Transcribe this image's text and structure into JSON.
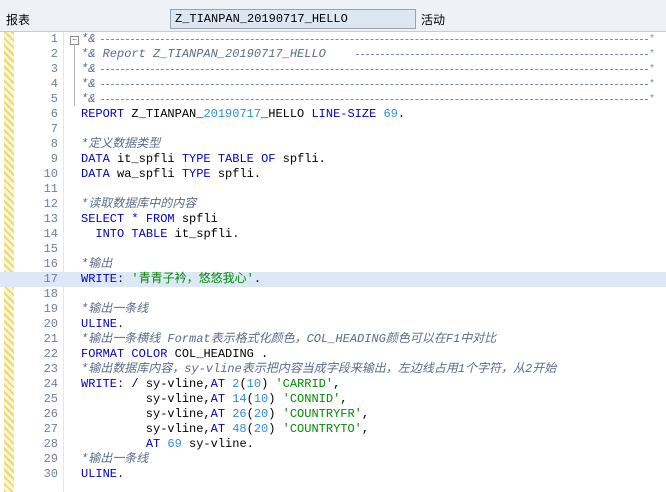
{
  "header": {
    "label": "报表",
    "program_name": "Z_TIANPAN_20190717_HELLO",
    "status": "活动"
  },
  "editor": {
    "highlighted_line": 17,
    "lines": [
      {
        "num": "1",
        "text": "*&"
      },
      {
        "num": "2",
        "text": "*& Report Z_TIANPAN_20190717_HELLO"
      },
      {
        "num": "3",
        "text": "*&"
      },
      {
        "num": "4",
        "text": "*&"
      },
      {
        "num": "5",
        "text": "*&"
      },
      {
        "num": "6",
        "text": "REPORT Z_TIANPAN_20190717_HELLO LINE-SIZE 69."
      },
      {
        "num": "7",
        "text": ""
      },
      {
        "num": "8",
        "text": "*定义数据类型"
      },
      {
        "num": "9",
        "text": "DATA it_spfli TYPE TABLE OF spfli."
      },
      {
        "num": "10",
        "text": "DATA wa_spfli TYPE spfli."
      },
      {
        "num": "11",
        "text": ""
      },
      {
        "num": "12",
        "text": "*读取数据库中的内容"
      },
      {
        "num": "13",
        "text": "SELECT * FROM spfli"
      },
      {
        "num": "14",
        "text": "  INTO TABLE it_spfli."
      },
      {
        "num": "15",
        "text": ""
      },
      {
        "num": "16",
        "text": "*输出"
      },
      {
        "num": "17",
        "text": "WRITE: '青青子衿，悠悠我心'."
      },
      {
        "num": "18",
        "text": ""
      },
      {
        "num": "19",
        "text": "*输出一条线"
      },
      {
        "num": "20",
        "text": "ULINE."
      },
      {
        "num": "21",
        "text": "*输出一条横线 Format表示格式化颜色，COL_HEADING颜色可以在F1中对比"
      },
      {
        "num": "22",
        "text": "FORMAT COLOR COL_HEADING ."
      },
      {
        "num": "23",
        "text": "*输出数据库内容，sy-vline表示把内容当成字段来输出，左边线占用1个字符，从2开始"
      },
      {
        "num": "24",
        "text": "WRITE: / sy-vline,AT 2(10) 'CARRID',"
      },
      {
        "num": "25",
        "text": "         sy-vline,AT 14(10) 'CONNID',"
      },
      {
        "num": "26",
        "text": "         sy-vline,AT 26(20) 'COUNTRYFR',"
      },
      {
        "num": "27",
        "text": "         sy-vline,AT 48(20) 'COUNTRYTO',"
      },
      {
        "num": "28",
        "text": "         AT 69 sy-vline."
      },
      {
        "num": "29",
        "text": "*输出一条线"
      },
      {
        "num": "30",
        "text": "ULINE."
      }
    ]
  }
}
